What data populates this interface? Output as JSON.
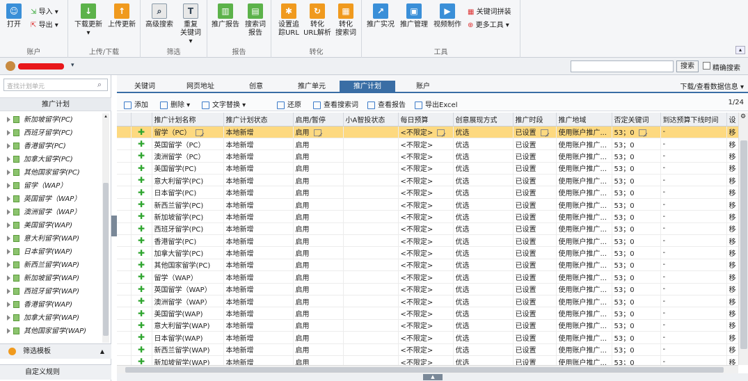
{
  "ribbon": {
    "account": {
      "open": "打开",
      "import": "导入",
      "export": "导出",
      "label": "账户"
    },
    "updown": {
      "download": "下载更新",
      "upload": "上传更新",
      "label": "上传/下载"
    },
    "filter": {
      "adv_search": "高级搜索",
      "recheck": "重复",
      "recheck2": "关键词",
      "label": "筛选"
    },
    "report": {
      "promo_report": "推广报告",
      "search_report": "搜索词",
      "search_report2": "报告",
      "label": "报告"
    },
    "convert": {
      "track_url": "设置追",
      "track_url2": "踪URL",
      "conv_parse": "转化",
      "conv_parse2": "URL解析",
      "conv_search": "转化",
      "conv_search2": "搜索词",
      "label": "转化"
    },
    "tools": {
      "realtime": "推广实况",
      "manage": "推广管理",
      "video": "视频制作",
      "keyword_concat": "关键词拼装",
      "more_tools": "更多工具",
      "label": "工具"
    }
  },
  "topbar": {
    "search_button": "搜索",
    "exact_search": "精确搜索"
  },
  "left": {
    "search_placeholder": "查找计划单元",
    "tree_title": "推广计划",
    "items": [
      "新加坡留学(PC)",
      "西班牙留学(PC)",
      "香港留学(PC)",
      "加拿大留学(PC)",
      "其他国家留学(PC)",
      "留学（WAP）",
      "英国留学（WAP）",
      "澳洲留学（WAP）",
      "美国留学(WAP)",
      "意大利留学(WAP)",
      "日本留学(WAP)",
      "新西兰留学(WAP)",
      "新加坡留学(WAP)",
      "西班牙留学(WAP)",
      "香港留学(WAP)",
      "加拿大留学(WAP)",
      "其他国家留学(WAP)"
    ],
    "filter_template": "筛选模板",
    "custom_rule": "自定义规则"
  },
  "tabs": {
    "items": [
      "关键词",
      "网页地址",
      "创意",
      "推广单元",
      "推广计划",
      "账户"
    ],
    "active": 4,
    "download_view": "下载/查看数据信息"
  },
  "toolbar": {
    "add": "添加",
    "delete": "删除",
    "replace": "文字替换",
    "restore": "还原",
    "view_search": "查看搜索词",
    "view_report": "查看报告",
    "export": "导出Excel",
    "page": "1/24"
  },
  "table": {
    "headers": [
      "推广计划名称",
      "推广计划状态",
      "启用/暂停",
      "小A智投状态",
      "每日预算",
      "创意展现方式",
      "推广时段",
      "推广地域",
      "否定关键词",
      "到达预算下线时间",
      "设"
    ],
    "rows": [
      [
        "留学（PC）",
        "本地新增",
        "启用",
        "",
        "<不限定>",
        "优选",
        "已设置",
        "使用账户推广...",
        "53；0",
        "-",
        "移"
      ],
      [
        "英国留学（PC）",
        "本地新增",
        "启用",
        "",
        "<不限定>",
        "优选",
        "已设置",
        "使用账户推广...",
        "53；0",
        "-",
        "移"
      ],
      [
        "澳洲留学（PC）",
        "本地新增",
        "启用",
        "",
        "<不限定>",
        "优选",
        "已设置",
        "使用账户推广...",
        "53；0",
        "-",
        "移"
      ],
      [
        "美国留学(PC)",
        "本地新增",
        "启用",
        "",
        "<不限定>",
        "优选",
        "已设置",
        "使用账户推广...",
        "53；0",
        "-",
        "移"
      ],
      [
        "意大利留学(PC)",
        "本地新增",
        "启用",
        "",
        "<不限定>",
        "优选",
        "已设置",
        "使用账户推广...",
        "53；0",
        "-",
        "移"
      ],
      [
        "日本留学(PC)",
        "本地新增",
        "启用",
        "",
        "<不限定>",
        "优选",
        "已设置",
        "使用账户推广...",
        "53；0",
        "-",
        "移"
      ],
      [
        "新西兰留学(PC)",
        "本地新增",
        "启用",
        "",
        "<不限定>",
        "优选",
        "已设置",
        "使用账户推广...",
        "53；0",
        "-",
        "移"
      ],
      [
        "新加坡留学(PC)",
        "本地新增",
        "启用",
        "",
        "<不限定>",
        "优选",
        "已设置",
        "使用账户推广...",
        "53；0",
        "-",
        "移"
      ],
      [
        "西班牙留学(PC)",
        "本地新增",
        "启用",
        "",
        "<不限定>",
        "优选",
        "已设置",
        "使用账户推广...",
        "53；0",
        "-",
        "移"
      ],
      [
        "香港留学(PC)",
        "本地新增",
        "启用",
        "",
        "<不限定>",
        "优选",
        "已设置",
        "使用账户推广...",
        "53；0",
        "-",
        "移"
      ],
      [
        "加拿大留学(PC)",
        "本地新增",
        "启用",
        "",
        "<不限定>",
        "优选",
        "已设置",
        "使用账户推广...",
        "53；0",
        "-",
        "移"
      ],
      [
        "其他国家留学(PC)",
        "本地新增",
        "启用",
        "",
        "<不限定>",
        "优选",
        "已设置",
        "使用账户推广...",
        "53；0",
        "-",
        "移"
      ],
      [
        "留学（WAP）",
        "本地新增",
        "启用",
        "",
        "<不限定>",
        "优选",
        "已设置",
        "使用账户推广...",
        "53；0",
        "-",
        "移"
      ],
      [
        "英国留学（WAP）",
        "本地新增",
        "启用",
        "",
        "<不限定>",
        "优选",
        "已设置",
        "使用账户推广...",
        "53；0",
        "-",
        "移"
      ],
      [
        "澳洲留学（WAP）",
        "本地新增",
        "启用",
        "",
        "<不限定>",
        "优选",
        "已设置",
        "使用账户推广...",
        "53；0",
        "-",
        "移"
      ],
      [
        "美国留学(WAP)",
        "本地新增",
        "启用",
        "",
        "<不限定>",
        "优选",
        "已设置",
        "使用账户推广...",
        "53；0",
        "-",
        "移"
      ],
      [
        "意大利留学(WAP)",
        "本地新增",
        "启用",
        "",
        "<不限定>",
        "优选",
        "已设置",
        "使用账户推广...",
        "53；0",
        "-",
        "移"
      ],
      [
        "日本留学(WAP)",
        "本地新增",
        "启用",
        "",
        "<不限定>",
        "优选",
        "已设置",
        "使用账户推广...",
        "53；0",
        "-",
        "移"
      ],
      [
        "新西兰留学(WAP)",
        "本地新增",
        "启用",
        "",
        "<不限定>",
        "优选",
        "已设置",
        "使用账户推广...",
        "53；0",
        "-",
        "移"
      ],
      [
        "新加坡留学(WAP)",
        "本地新增",
        "启用",
        "",
        "<不限定>",
        "优选",
        "已设置",
        "使用账户推广...",
        "53；0",
        "-",
        "移"
      ]
    ]
  }
}
